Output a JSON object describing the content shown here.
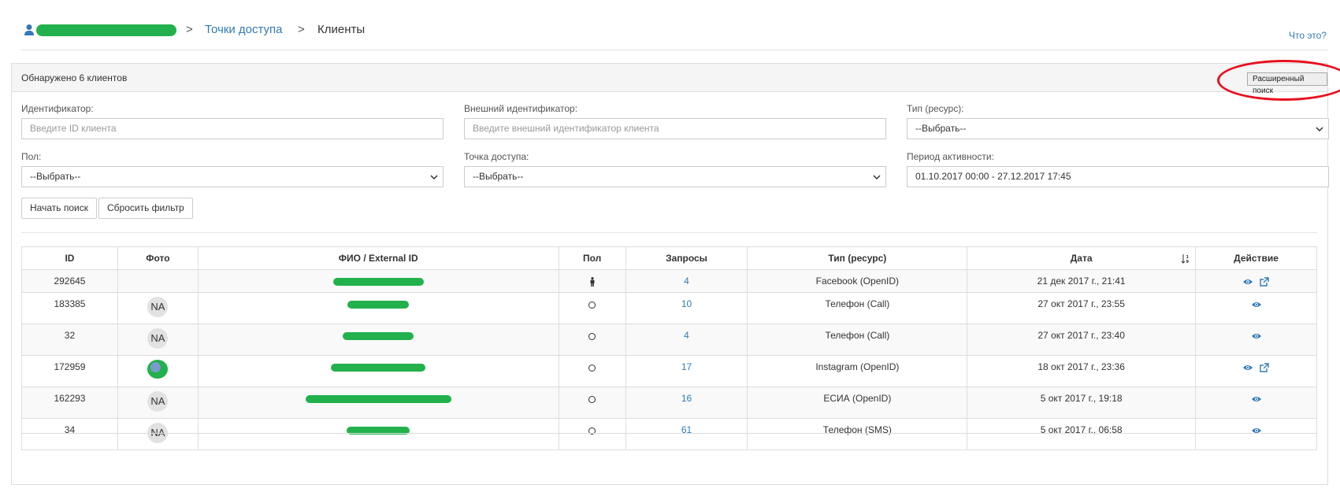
{
  "breadcrumb": {
    "access_points": "Точки доступа",
    "current": "Клиенты",
    "separator": ">"
  },
  "help_link": "Что это?",
  "panel": {
    "title": "Обнаружено 6 клиентов",
    "advanced_search": "Расширенный поиск"
  },
  "filters": {
    "id": {
      "label": "Идентификатор:",
      "placeholder": "Введите ID клиента"
    },
    "external_id": {
      "label": "Внешний идентификатор:",
      "placeholder": "Введите внешний идентификатор клиента"
    },
    "type": {
      "label": "Тип (ресурс):",
      "value": "--Выбрать--"
    },
    "gender": {
      "label": "Пол:",
      "value": "--Выбрать--"
    },
    "access_point": {
      "label": "Точка доступа:",
      "value": "--Выбрать--"
    },
    "period": {
      "label": "Период активности:",
      "value": "01.10.2017 00:00 - 27.12.2017 17:45"
    },
    "search_button": "Начать поиск",
    "reset_button": "Сбросить фильтр"
  },
  "table": {
    "headers": [
      "ID",
      "Фото",
      "ФИО / External ID",
      "Пол",
      "Запросы",
      "Тип (ресурс)",
      "Дата",
      "Действие"
    ],
    "rows": [
      {
        "id": "292645",
        "photo": "",
        "requests": "4",
        "type": "Facebook (OpenID)",
        "date": "21 дек 2017 г., 21:41",
        "gender": "male",
        "external": true
      },
      {
        "id": "183385",
        "photo": "NA",
        "requests": "10",
        "type": "Телефон (Call)",
        "date": "27 окт 2017 г., 23:55",
        "gender": "unknown",
        "external": false
      },
      {
        "id": "32",
        "photo": "NA",
        "requests": "4",
        "type": "Телефон (Call)",
        "date": "27 окт 2017 г., 23:40",
        "gender": "unknown",
        "external": false
      },
      {
        "id": "172959",
        "photo": "image",
        "requests": "17",
        "type": "Instagram (OpenID)",
        "date": "18 окт 2017 г., 23:36",
        "gender": "unknown",
        "external": true
      },
      {
        "id": "162293",
        "photo": "NA",
        "requests": "16",
        "type": "ЕСИА (OpenID)",
        "date": "5 окт 2017 г., 19:18",
        "gender": "unknown",
        "external": false
      },
      {
        "id": "34",
        "photo": "NA",
        "requests": "61",
        "type": "Телефон (SMS)",
        "date": "5 окт 2017 г., 06:58",
        "gender": "unknown",
        "external": false
      }
    ]
  },
  "colors": {
    "link": "#337ab7",
    "censor": "#22b14c",
    "highlight": "#e8101f"
  },
  "icons": [
    "user-icon",
    "chevron-down-icon",
    "sort-icon",
    "eye-icon",
    "external-link-icon",
    "male-icon",
    "circle-icon"
  ]
}
